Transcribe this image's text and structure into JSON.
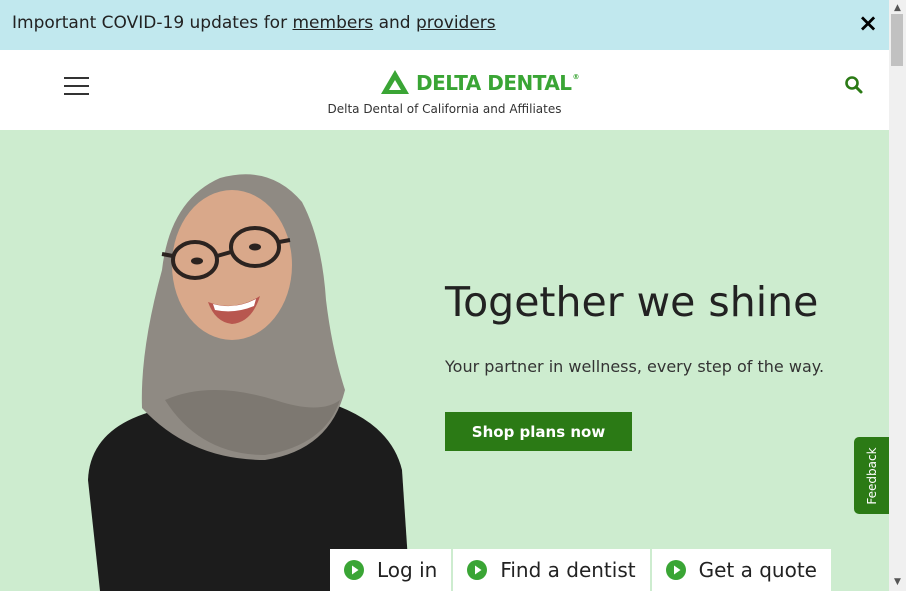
{
  "alert": {
    "prefix": "Important COVID-19 updates for ",
    "members_link": "members",
    "conjunction": " and ",
    "providers_link": "providers",
    "close_icon": "×"
  },
  "header": {
    "logo_text": "DELTA DENTAL",
    "logo_reg": "®",
    "subline": "Delta Dental of California and Affiliates",
    "brand_color": "#3aa535"
  },
  "hero": {
    "headline": "Together we shine",
    "tagline": "Your partner in wellness, every step of the way.",
    "cta_label": "Shop plans now",
    "background": "#cdeccf",
    "cta_color": "#2b7a15"
  },
  "feedback": {
    "label": "Feedback"
  },
  "quick_links": [
    {
      "label": "Log in",
      "icon": "play-circle-icon"
    },
    {
      "label": "Find a dentist",
      "icon": "play-circle-icon"
    },
    {
      "label": "Get a quote",
      "icon": "play-circle-icon"
    }
  ],
  "scrollbar": {
    "up_arrow": "▲",
    "down_arrow": "▼"
  }
}
